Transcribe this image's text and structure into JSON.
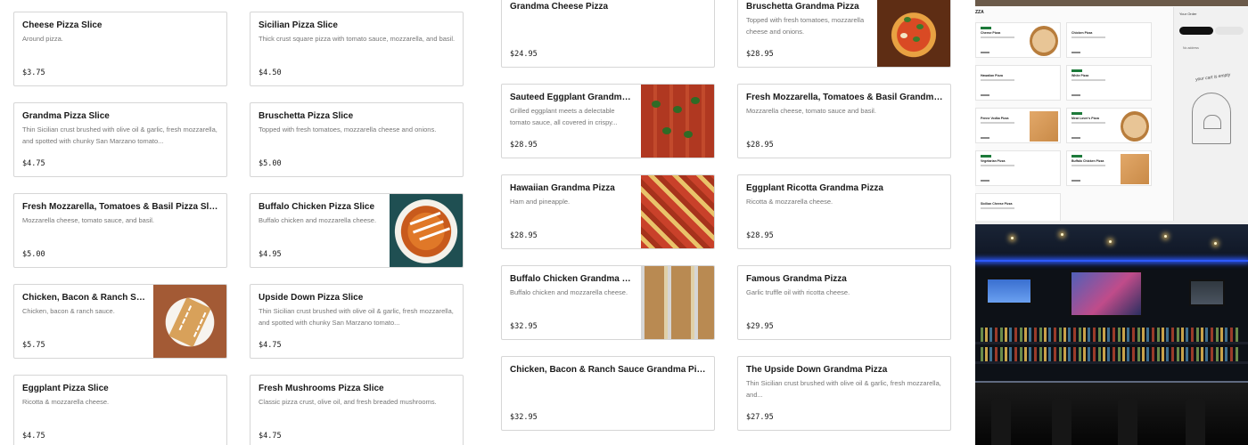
{
  "currency_prices_note": "",
  "left_menu": [
    {
      "name": "Cheese Pizza Slice",
      "desc": "Around pizza.",
      "price": "$3.75",
      "image": ""
    },
    {
      "name": "Sicilian Pizza Slice",
      "desc": "Thick crust square pizza with tomato sauce, mozzarella, and basil.",
      "price": "$4.50",
      "image": ""
    },
    {
      "name": "Grandma Pizza Slice",
      "desc": "Thin Sicilian crust brushed with olive oil & garlic, fresh mozzarella, and spotted with chunky San Marzano tomato...",
      "price": "$4.75",
      "image": ""
    },
    {
      "name": "Bruschetta Pizza Slice",
      "desc": "Topped with fresh tomatoes, mozzarella cheese and onions.",
      "price": "$5.00",
      "image": ""
    },
    {
      "name": "Fresh Mozzarella, Tomatoes & Basil Pizza Slice",
      "desc": "Mozzarella cheese, tomato sauce, and basil.",
      "price": "$5.00",
      "image": ""
    },
    {
      "name": "Buffalo Chicken Pizza Slice",
      "desc": "Buffalo chicken and mozzarella cheese.",
      "price": "$4.95",
      "image": "buffalo-slice"
    },
    {
      "name": "Chicken, Bacon & Ranch Sauce...",
      "desc": "Chicken, bacon & ranch sauce.",
      "price": "$5.75",
      "image": "ranch"
    },
    {
      "name": "Upside Down Pizza Slice",
      "desc": "Thin Sicilian crust brushed with olive oil & garlic, fresh mozzarella, and spotted with chunky San Marzano tomato...",
      "price": "$4.75",
      "image": ""
    },
    {
      "name": "Eggplant Pizza Slice",
      "desc": "Ricotta & mozzarella cheese.",
      "price": "$4.75",
      "image": ""
    },
    {
      "name": "Fresh Mushrooms Pizza Slice",
      "desc": "Classic pizza crust, olive oil, and fresh breaded mushrooms.",
      "price": "$4.75",
      "image": ""
    }
  ],
  "mid_menu": [
    {
      "name": "Grandma Cheese Pizza",
      "desc": "",
      "price": "$24.95",
      "image": ""
    },
    {
      "name": "Bruschetta Grandma Pizza",
      "desc": "Topped with fresh tomatoes, mozzarella cheese and onions.",
      "price": "$28.95",
      "image": "pizza-marg"
    },
    {
      "name": "Sauteed Eggplant Grandma Pizza",
      "desc": "Grilled eggplant meets a delectable tomato sauce, all covered in crispy...",
      "price": "$28.95",
      "image": "eggplant"
    },
    {
      "name": "Fresh Mozzarella, Tomatoes & Basil Grandma Pizza",
      "desc": "Mozzarella cheese, tomato sauce and basil.",
      "price": "$28.95",
      "image": ""
    },
    {
      "name": "Hawaiian Grandma Pizza",
      "desc": "Ham and pineapple.",
      "price": "$28.95",
      "image": "hawaiian"
    },
    {
      "name": "Eggplant Ricotta Grandma Pizza",
      "desc": "Ricotta & mozzarella cheese.",
      "price": "$28.95",
      "image": ""
    },
    {
      "name": "Buffalo Chicken Grandma Pizza",
      "desc": "Buffalo chicken and mozzarella cheese.",
      "price": "$32.95",
      "image": "buffalo-tray"
    },
    {
      "name": "Famous Grandma Pizza",
      "desc": "Garlic truffle oil with ricotta cheese.",
      "price": "$29.95",
      "image": ""
    },
    {
      "name": "Chicken, Bacon & Ranch Sauce Grandma Pizza",
      "desc": "",
      "price": "$32.95",
      "image": ""
    },
    {
      "name": "The Upside Down Grandma Pizza",
      "desc": "Thin Sicilian crust brushed with olive oil & garlic, fresh mozzarella, and...",
      "price": "$27.95",
      "image": ""
    }
  ],
  "site_preview": {
    "brand": "ZZA",
    "order_title": "Your Order",
    "address": "No address",
    "empty_cart": "your cart is empty",
    "cards": [
      {
        "name": "Cheese Pizza",
        "badge": true,
        "img": "round"
      },
      {
        "name": "Chicken Pizza",
        "badge": false,
        "img": ""
      },
      {
        "name": "Hawaiian Pizza",
        "badge": false,
        "img": ""
      },
      {
        "name": "White Pizza",
        "badge": true,
        "img": ""
      },
      {
        "name": "Penne Vodka Pizza",
        "badge": false,
        "img": "square"
      },
      {
        "name": "Meat Lover's Pizza",
        "badge": true,
        "img": "round"
      },
      {
        "name": "Vegetarian Pizza",
        "badge": true,
        "img": ""
      },
      {
        "name": "Buffalo Chicken Pizza",
        "badge": true,
        "img": "square"
      },
      {
        "name": "Sicilian Cheese Pizza",
        "badge": false,
        "img": ""
      }
    ]
  },
  "colors": {
    "card_border": "#d6d6d6",
    "text_primary": "#191919",
    "text_secondary": "#767676",
    "badge_green": "#1d7a3a"
  }
}
